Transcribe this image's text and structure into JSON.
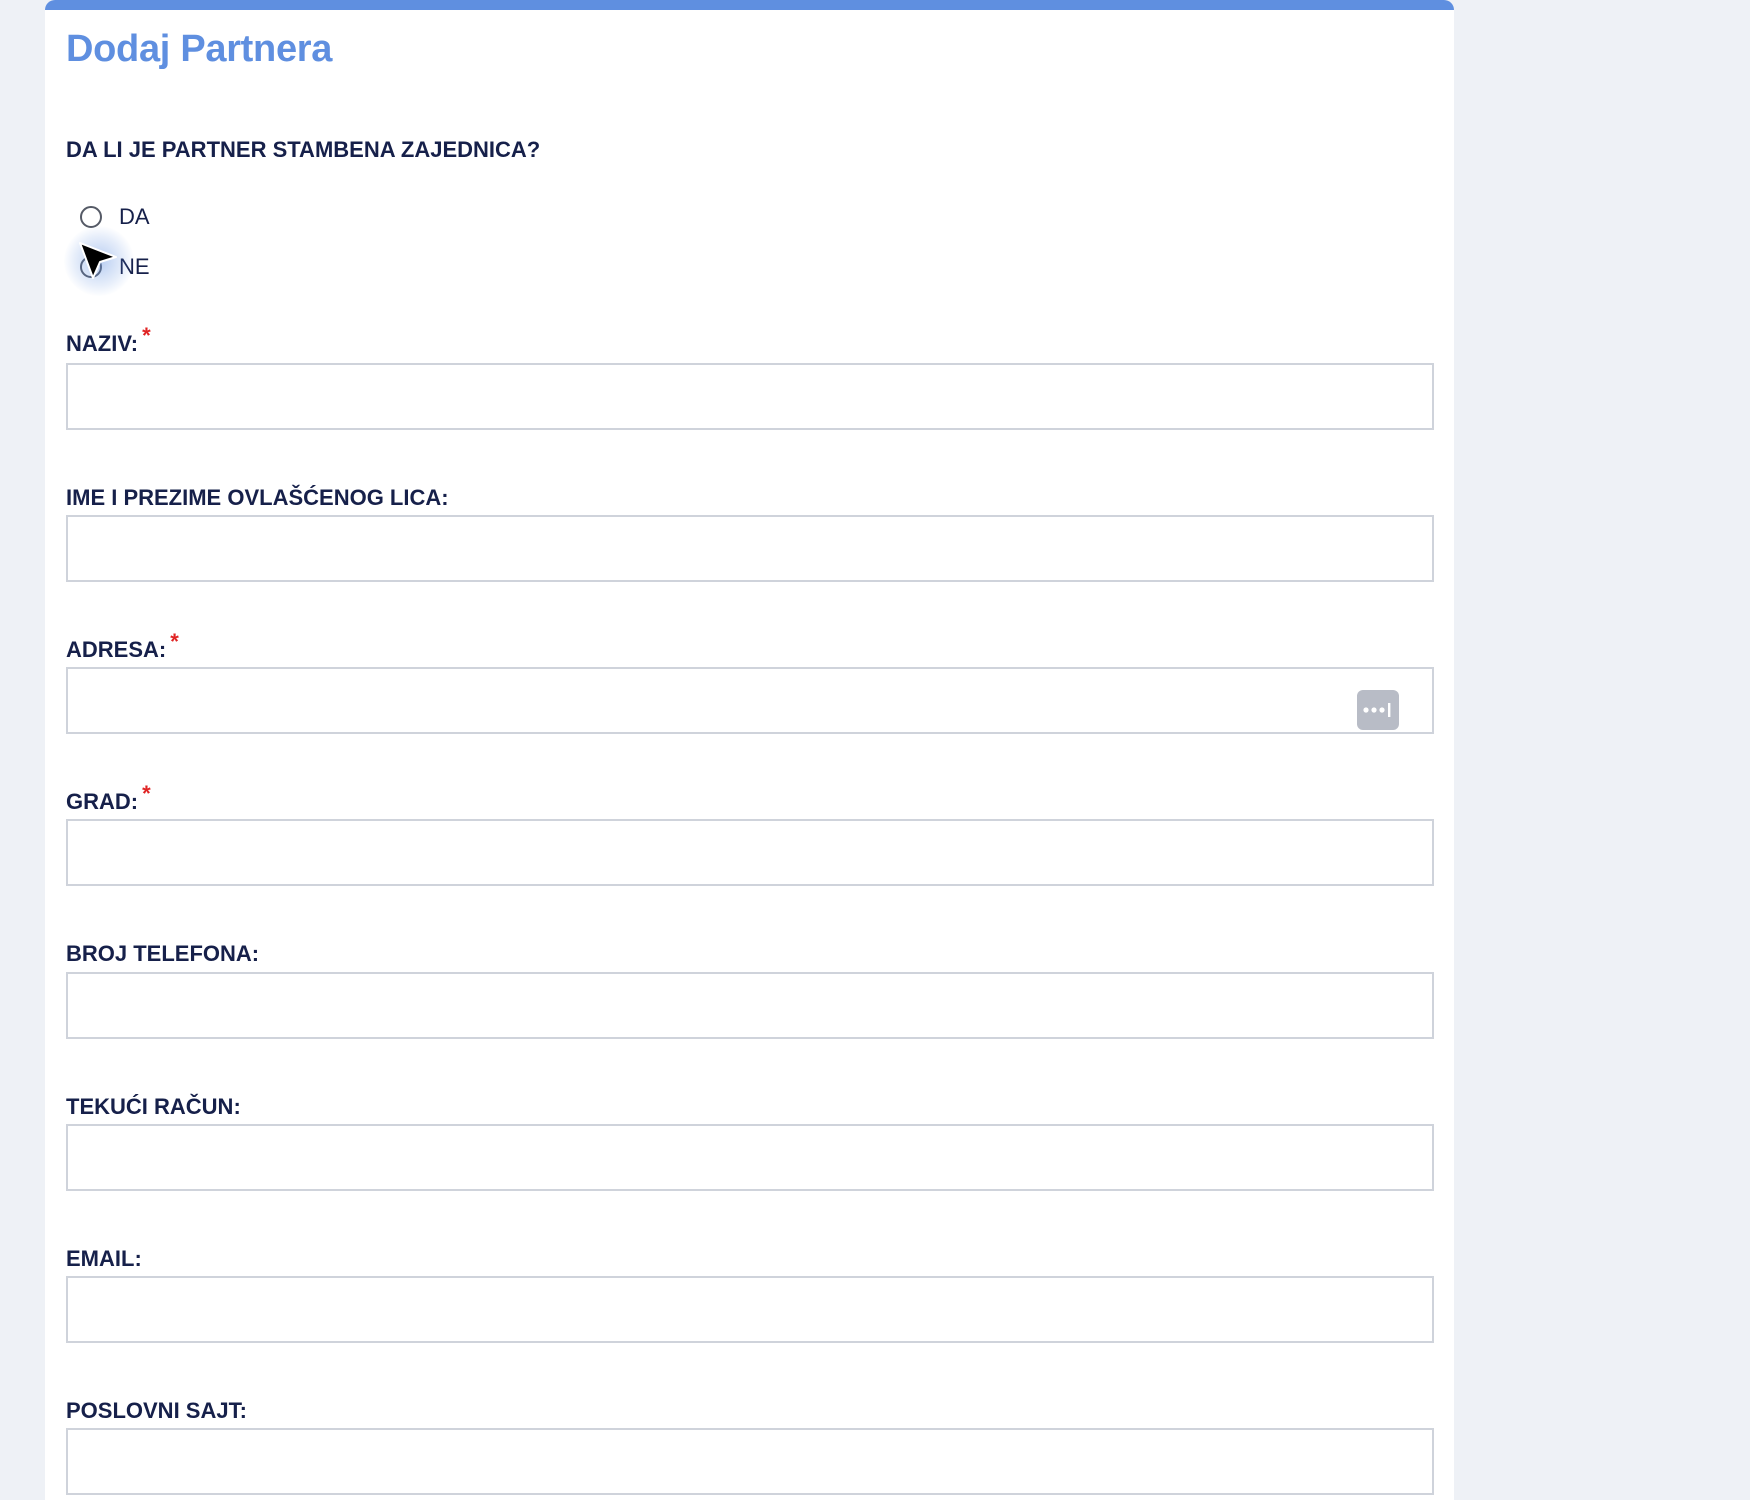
{
  "form": {
    "title": "Dodaj Partnera",
    "question": "DA LI JE PARTNER STAMBENA ZAJEDNICA?",
    "options": [
      {
        "label": "DA",
        "selected": false
      },
      {
        "label": "NE",
        "selected": false
      }
    ],
    "required_mark": "*",
    "fields": {
      "naziv": {
        "label": "NAZIV:",
        "value": "",
        "required": true
      },
      "ovlasceno_lice": {
        "label": "IME I PREZIME OVLAŠĆENOG LICA:",
        "value": "",
        "required": false
      },
      "adresa": {
        "label": "ADRESA:",
        "value": "",
        "required": true
      },
      "grad": {
        "label": "GRAD:",
        "value": "",
        "required": true
      },
      "telefon": {
        "label": "BROJ TELEFONA:",
        "value": "",
        "required": false
      },
      "tekuci_racun": {
        "label": "TEKUĆI RAČUN:",
        "value": "",
        "required": false
      },
      "email": {
        "label": "EMAIL:",
        "value": "",
        "required": false
      },
      "poslovni_sajt": {
        "label": "POSLOVNI SAJT:",
        "value": "",
        "required": false
      }
    }
  },
  "icons": {
    "address_action": "more-dots-icon",
    "pointer": "mouse-cursor-icon"
  },
  "colors": {
    "accent": "#5f8fe0",
    "label": "#16204a",
    "required": "#e02424",
    "background": "#eef1f6",
    "input_border": "#cfd3db"
  }
}
